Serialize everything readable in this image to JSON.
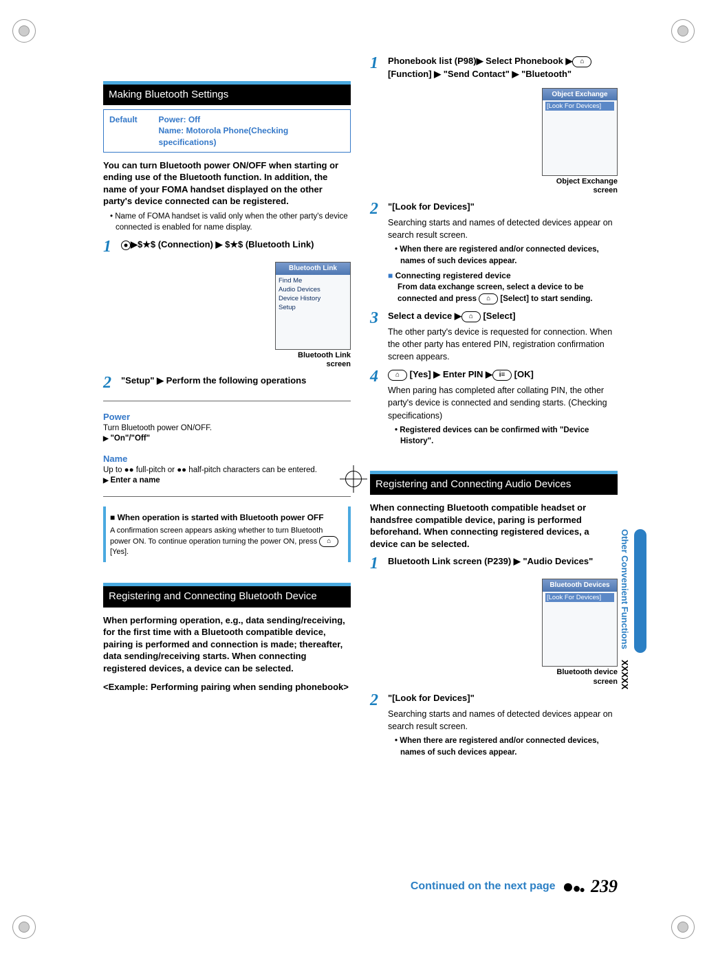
{
  "left": {
    "section1_title": "Making Bluetooth Settings",
    "default_label": "Default",
    "default_val_line1": "Power: Off",
    "default_val_line2": "Name: Motorola Phone(Checking specifications)",
    "intro": "You can turn Bluetooth power ON/OFF when starting or ending use of the Bluetooth function. In addition, the name of your FOMA handset displayed on the other party's device connected can be registered.",
    "bullet1": "Name of FOMA handset is valid only when the other party's device connected is enabled for name display.",
    "step1_num": "1",
    "step1_body_a": "$★$ (Connection) ",
    "step1_body_b": " $★$ (Bluetooth Link)",
    "shot1_title": "Bluetooth Link",
    "shot1_l1": "Find Me",
    "shot1_l2": "Audio Devices",
    "shot1_l3": "Device History",
    "shot1_l4": "Setup",
    "shot1_caption": "Bluetooth Link screen",
    "step2_num": "2",
    "step2_body": "\"Setup\" ▶ Perform the following operations",
    "power_head": "Power",
    "power_desc": "Turn Bluetooth power ON/OFF.",
    "power_opt": "\"On\"/\"Off\"",
    "name_head": "Name",
    "name_desc": "Up to ●● full-pitch or ●● half-pitch characters can be entered.",
    "name_opt": "Enter a name",
    "note_head": "When operation is started with Bluetooth power OFF",
    "note_body": "A confirmation screen appears asking whether to turn Bluetooth power ON. To continue operation turning the power ON, press ",
    "note_body_end": " [Yes].",
    "section2_title": "Registering and Connecting Bluetooth Device",
    "sec2_intro": "When performing operation, e.g., data sending/receiving, for the first time with a Bluetooth compatible device, pairing is performed and connection is made; thereafter, data sending/receiving starts. When connecting registered devices, a device can be selected.",
    "example": "<Example: Performing pairing when sending phonebook>"
  },
  "right": {
    "r_step1_num": "1",
    "r_step1_body_a": "Phonebook list (P98)▶ Select Phonebook ▶",
    "r_step1_body_b": " [Function] ▶ \"Send Contact\" ▶ \"Bluetooth\"",
    "shot2_title": "Object Exchange",
    "shot2_l1": "[Look For Devices]",
    "shot2_caption": "Object Exchange screen",
    "r_step2_num": "2",
    "r_step2_body": "\"[Look for Devices]\"",
    "r_step2_text": "Searching starts and names of detected devices appear on search result screen.",
    "r_step2_bullet": "When there are registered and/or connected devices, names of such devices appear.",
    "connecting_head": "Connecting registered device",
    "connecting_body_a": "From data exchange screen, select a device to be connected and press ",
    "connecting_body_b": " [Select] to start sending.",
    "r_step3_num": "3",
    "r_step3_body_a": "Select a device ▶",
    "r_step3_body_b": " [Select]",
    "r_step3_text": "The other party's device is requested for connection. When the other party has entered PIN, registration confirmation screen appears.",
    "r_step4_num": "4",
    "r_step4_body_a": " [Yes] ▶ Enter PIN ▶",
    "r_step4_body_b": " [OK]",
    "r_step4_text": "When paring has completed after collating PIN, the other party's device is connected and sending starts. (Checking specifications)",
    "r_step4_bullet": "Registered devices can be confirmed with \"Device History\".",
    "section3_title": "Registering and Connecting Audio Devices",
    "sec3_intro": "When connecting Bluetooth compatible headset or handsfree compatible device, paring is performed beforehand. When connecting registered devices, a device can be selected.",
    "a_step1_num": "1",
    "a_step1_body": "Bluetooth Link screen (P239) ▶ \"Audio Devices\"",
    "shot3_title": "Bluetooth Devices",
    "shot3_l1": "[Look For Devices]",
    "shot3_caption": "Bluetooth device screen",
    "a_step2_num": "2",
    "a_step2_body": "\"[Look for Devices]\"",
    "a_step2_text": "Searching starts and names of detected devices appear on search result screen.",
    "a_step2_bullet": "When there are registered and/or connected devices, names of such devices appear."
  },
  "side": {
    "tab": "Other Convenient Functions",
    "xxxxx": "XXXXX"
  },
  "footer": {
    "continued": "Continued on the next page",
    "page": "239"
  },
  "keys": {
    "fn": "⌂",
    "ok": "i≡"
  }
}
